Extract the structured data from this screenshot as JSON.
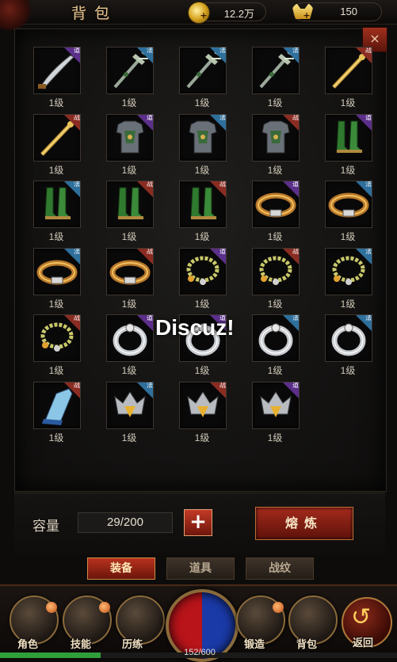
{
  "header": {
    "title": "背包",
    "gold": "12.2万",
    "ingot": "150",
    "close_label": "×"
  },
  "level_label": "1级",
  "watermark": "Discuz!",
  "items": [
    {
      "tag": "道",
      "tag_class": "dao",
      "kind": "scimitar"
    },
    {
      "tag": "法",
      "tag_class": "fa",
      "kind": "trident"
    },
    {
      "tag": "法",
      "tag_class": "fa",
      "kind": "trident"
    },
    {
      "tag": "法",
      "tag_class": "fa",
      "kind": "trident"
    },
    {
      "tag": "战",
      "tag_class": "zhan",
      "kind": "staff"
    },
    {
      "tag": "战",
      "tag_class": "zhan",
      "kind": "staff"
    },
    {
      "tag": "道",
      "tag_class": "dao",
      "kind": "armor"
    },
    {
      "tag": "法",
      "tag_class": "fa",
      "kind": "armor"
    },
    {
      "tag": "战",
      "tag_class": "zhan",
      "kind": "armor"
    },
    {
      "tag": "道",
      "tag_class": "dao",
      "kind": "boots"
    },
    {
      "tag": "法",
      "tag_class": "fa",
      "kind": "boots"
    },
    {
      "tag": "战",
      "tag_class": "zhan",
      "kind": "boots"
    },
    {
      "tag": "战",
      "tag_class": "zhan",
      "kind": "boots"
    },
    {
      "tag": "道",
      "tag_class": "dao",
      "kind": "belt"
    },
    {
      "tag": "法",
      "tag_class": "fa",
      "kind": "belt"
    },
    {
      "tag": "法",
      "tag_class": "fa",
      "kind": "belt"
    },
    {
      "tag": "战",
      "tag_class": "zhan",
      "kind": "belt"
    },
    {
      "tag": "道",
      "tag_class": "dao",
      "kind": "necklace"
    },
    {
      "tag": "战",
      "tag_class": "zhan",
      "kind": "necklace"
    },
    {
      "tag": "法",
      "tag_class": "fa",
      "kind": "necklace"
    },
    {
      "tag": "战",
      "tag_class": "zhan",
      "kind": "necklace"
    },
    {
      "tag": "道",
      "tag_class": "dao",
      "kind": "ring"
    },
    {
      "tag": "道",
      "tag_class": "dao",
      "kind": "ring"
    },
    {
      "tag": "法",
      "tag_class": "fa",
      "kind": "ring"
    },
    {
      "tag": "法",
      "tag_class": "fa",
      "kind": "ring"
    },
    {
      "tag": "战",
      "tag_class": "zhan",
      "kind": "bracer"
    },
    {
      "tag": "法",
      "tag_class": "fa",
      "kind": "helmet"
    },
    {
      "tag": "战",
      "tag_class": "zhan",
      "kind": "helmet"
    },
    {
      "tag": "道",
      "tag_class": "dao",
      "kind": "helmet"
    }
  ],
  "capacity": {
    "label": "容量",
    "value": "29/200",
    "plus_label": "+",
    "smelt_label": "熔炼"
  },
  "tabs": [
    {
      "label": "装备",
      "active": true
    },
    {
      "label": "道具",
      "active": false
    },
    {
      "label": "战纹",
      "active": false
    }
  ],
  "nav": [
    {
      "label": "角色"
    },
    {
      "label": "技能"
    },
    {
      "label": "历练"
    },
    {
      "label": "锻造"
    },
    {
      "label": "背包"
    },
    {
      "label": "返回"
    }
  ],
  "hp": {
    "text": "152/600",
    "fraction": 0.253
  },
  "colors": {
    "accent_red": "#a32a1c",
    "gold_text": "#e6c896",
    "tag_dao": "#5b2f8a",
    "tag_fa": "#2e6f9c",
    "tag_zhan": "#8a2c22"
  }
}
